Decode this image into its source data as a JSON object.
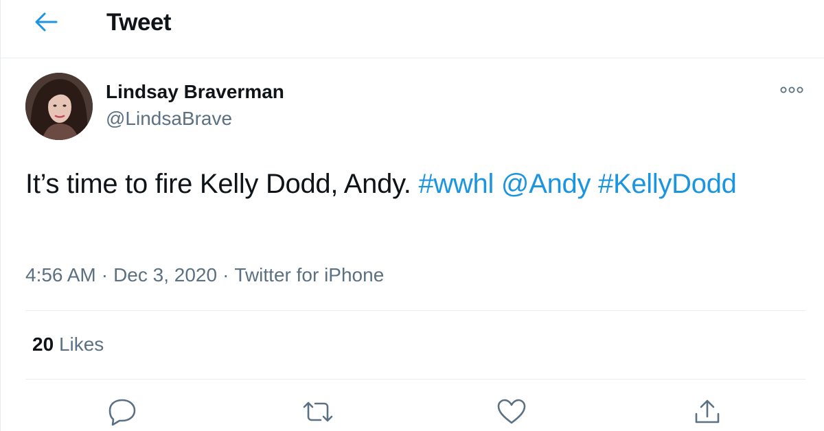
{
  "header": {
    "title": "Tweet",
    "back_icon": "arrow-left-icon",
    "accent": "#1b95e0"
  },
  "user": {
    "name": "Lindsay Braverman",
    "handle": "@LindsaBrave"
  },
  "tweet": {
    "text_segments": [
      {
        "text": "It’s time to fire Kelly Dodd, Andy. ",
        "type": "text"
      },
      {
        "text": "#wwhl",
        "type": "hashtag"
      },
      {
        "text": " ",
        "type": "text"
      },
      {
        "text": "@Andy",
        "type": "mention"
      },
      {
        "text": " ",
        "type": "text"
      },
      {
        "text": "#KellyDodd",
        "type": "hashtag"
      }
    ],
    "time": "4:56 AM",
    "separator": "·",
    "date": "Dec 3, 2020",
    "source": "Twitter for iPhone"
  },
  "stats": {
    "likes_count": "20",
    "likes_label": "Likes"
  },
  "actions": [
    {
      "name": "reply",
      "icon": "reply-icon"
    },
    {
      "name": "retweet",
      "icon": "retweet-icon"
    },
    {
      "name": "like",
      "icon": "heart-icon"
    },
    {
      "name": "share",
      "icon": "share-icon"
    }
  ],
  "colors": {
    "text": "#0f1419",
    "secondary": "#5b7083",
    "link": "#1b95e0",
    "divider": "#e6ecf0"
  }
}
